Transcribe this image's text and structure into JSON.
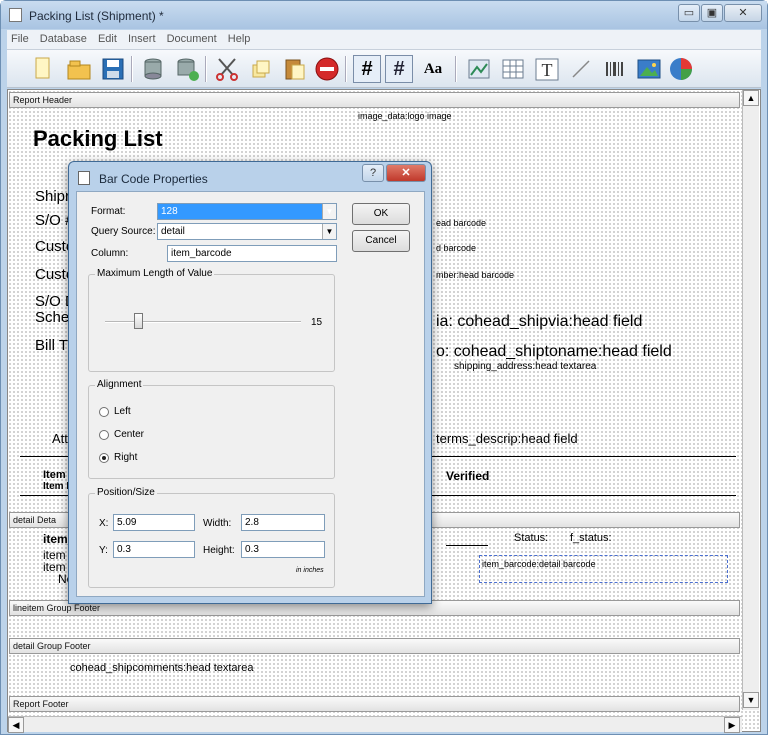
{
  "window": {
    "title": "Packing List (Shipment) *",
    "minimize_glyph": "▭",
    "maximize_glyph": "▣",
    "close_glyph": "✕"
  },
  "menu": [
    "File",
    "Database",
    "Edit",
    "Insert",
    "Document",
    "Help"
  ],
  "toolbar": {
    "icons": [
      "new-document-icon",
      "open-folder-icon",
      "save-disk-icon",
      "database-icon",
      "database-add-icon",
      "cut-scissors-icon",
      "copy-icon",
      "paste-icon",
      "delete-stop-icon",
      "grid-icon",
      "snap-grid-icon",
      "font-icon",
      "insert-image-icon",
      "insert-table-icon",
      "insert-text-icon",
      "insert-line-icon",
      "insert-barcode-icon",
      "insert-picture-icon",
      "insert-chart-icon"
    ],
    "grid_glyph": "#",
    "font_glyph": "Aa"
  },
  "report": {
    "sections": {
      "report_header": "Report Header",
      "detail_detail": "detail Deta",
      "lineitem_footer": "lineitem Group Footer",
      "detail_footer": "detail Group Footer",
      "report_footer": "Report Footer"
    },
    "logo_text": "image_data:logo image",
    "title": "Packing List",
    "left_labels": [
      "Shipr",
      "S/O #",
      "Custo",
      "Custo",
      "S/O D",
      "Sche",
      "Bill T"
    ],
    "attn_label": "Atte",
    "right_fields": {
      "head_barcode_1": "ead barcode",
      "head_barcode_2": "d barcode",
      "number_barcode": "mber:head barcode",
      "shipvia": "ia: cohead_shipvia:head field",
      "shipto": "o: cohead_shiptoname:head field",
      "shipping_address": "shipping_address:head textarea",
      "terms": "terms_descrip:head field"
    },
    "columns": {
      "item": "Item",
      "item_d": "Item D",
      "verified": "Verified"
    },
    "detail": {
      "item_bold": "item_",
      "item1": "item",
      "item2": "item",
      "no": "No",
      "status_label": "Status:",
      "status_field": "f_status:",
      "barcode": "item_barcode:detail barcode"
    },
    "shipcomments": "cohead_shipcomments:head textarea"
  },
  "dialog": {
    "title": "Bar Code Properties",
    "help_glyph": "?",
    "close_glyph": "✕",
    "format_label": "Format:",
    "format_value": "128",
    "query_label": "Query Source:",
    "query_value": "detail",
    "column_label": "Column:",
    "column_value": "item_barcode",
    "ok_label": "OK",
    "cancel_label": "Cancel",
    "maxlen_group": "Maximum Length of Value",
    "maxlen_value": "15",
    "alignment_group": "Alignment",
    "align_options": [
      "Left",
      "Center",
      "Right"
    ],
    "align_selected": "Right",
    "position_group": "Position/Size",
    "x_label": "X:",
    "x_value": "5.09",
    "width_label": "Width:",
    "width_value": "2.8",
    "y_label": "Y:",
    "y_value": "0.3",
    "height_label": "Height:",
    "height_value": "0.3",
    "units": "in inches"
  }
}
